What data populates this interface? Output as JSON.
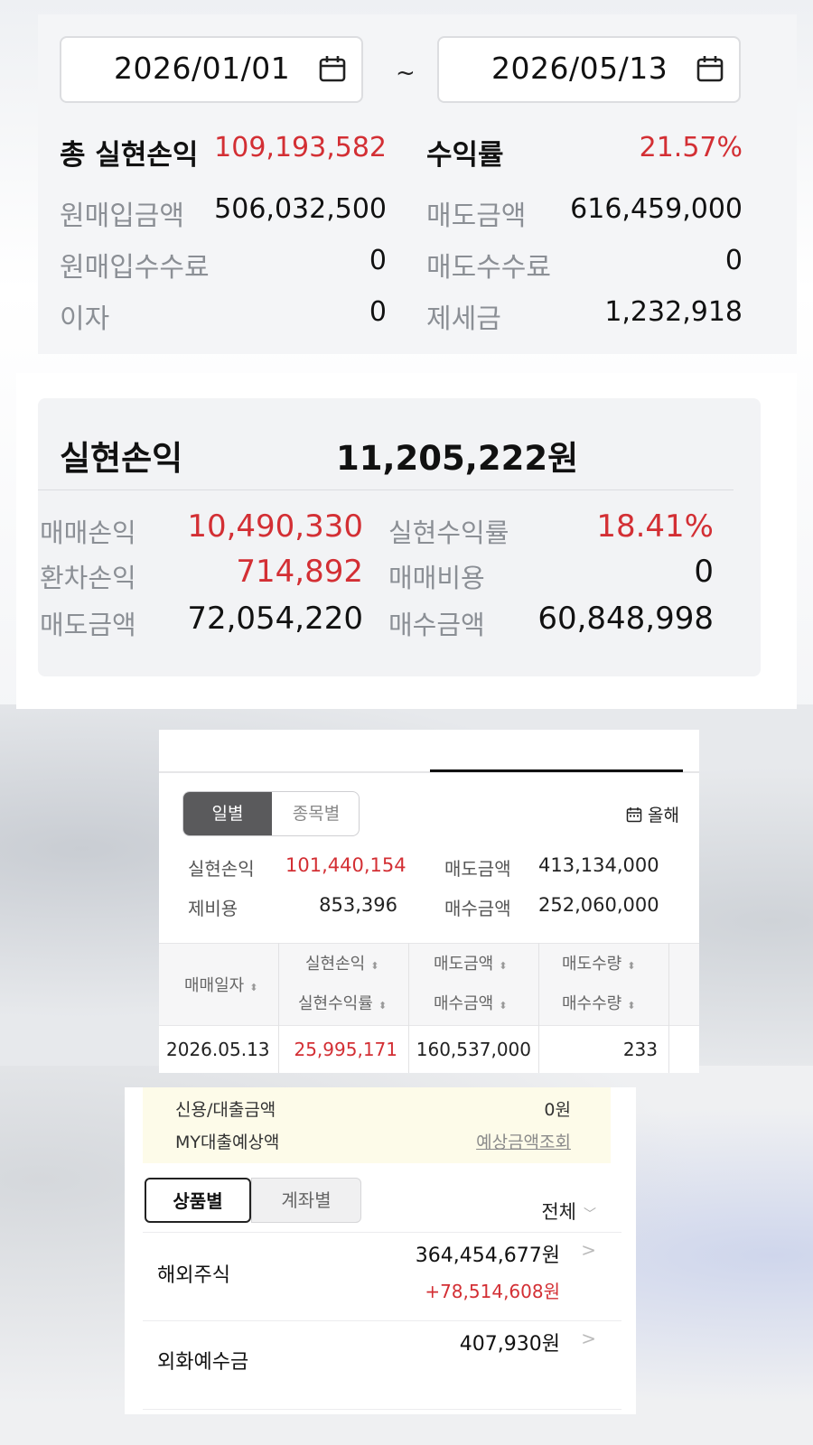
{
  "colors": {
    "profit_red": "#d32f34",
    "label_gray": "#8b8f95",
    "panel_bg": "#f4f5f7",
    "loan_bg": "#fdfbe9"
  },
  "panel1": {
    "start_date": "2026/01/01",
    "end_date": "2026/05/13",
    "separator": "~",
    "calendar_icon": "calendar-icon",
    "total_label": "총 실현손익",
    "total_value": "109,193,582",
    "rate_label": "수익률",
    "rate_value": "21.57%",
    "rows": [
      {
        "label": "원매입금액",
        "value": "506,032,500",
        "label2": "매도금액",
        "value2": "616,459,000"
      },
      {
        "label": "원매입수수료",
        "value": "0",
        "label2": "매도수수료",
        "value2": "0"
      },
      {
        "label": "이자",
        "value": "0",
        "label2": "제세금",
        "value2": "1,232,918"
      }
    ]
  },
  "panel2": {
    "title": "실현손익",
    "total": "11,205,222원",
    "rows": [
      {
        "label": "매매손익",
        "value": "10,490,330",
        "label2": "실현수익률",
        "value2": "18.41%"
      },
      {
        "label": "환차손익",
        "value": "714,892",
        "label2": "매매비용",
        "value2": "0"
      },
      {
        "label": "매도금액",
        "value": "72,054,220",
        "label2": "매수금액",
        "value2": "60,848,998"
      }
    ]
  },
  "panel3": {
    "segment_on": "일별",
    "segment_off": "종목별",
    "period": "올해",
    "summary": [
      {
        "label": "실현손익",
        "value": "101,440,154",
        "label2": "매도금액",
        "value2": "413,134,000"
      },
      {
        "label": "제비용",
        "value": "853,396",
        "label2": "매수금액",
        "value2": "252,060,000"
      }
    ],
    "headers": {
      "date": "매매일자",
      "col1_top": "실현손익",
      "col1_bottom": "실현수익률",
      "col2_top": "매도금액",
      "col2_bottom": "매수금액",
      "col3_top": "매도수량",
      "col3_bottom": "매수수량",
      "sort_icon": "⬍"
    },
    "row": {
      "date": "2026.05.13",
      "profit": "25,995,171",
      "sell_amount": "160,537,000",
      "sell_qty": "233"
    }
  },
  "panel4": {
    "loan_label": "신용/대출금액",
    "loan_value": "0원",
    "my_loan_label": "MY대출예상액",
    "my_loan_link": "예상금액조회",
    "tab_on": "상품별",
    "tab_off": "계좌별",
    "filter": "전체",
    "items": [
      {
        "name": "해외주식",
        "value": "364,454,677원",
        "change": "+78,514,608원"
      },
      {
        "name": "외화예수금",
        "value": "407,930원"
      }
    ]
  }
}
